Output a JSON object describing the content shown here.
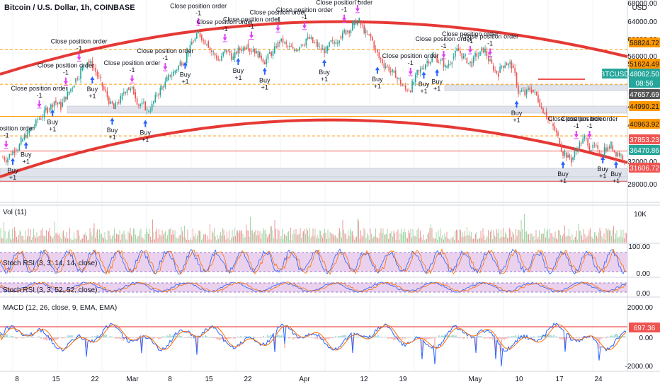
{
  "header": {
    "title": "Bitcoin / U.S. Dollar, 1h, COINBASE",
    "currency": "USD"
  },
  "chart_data": {
    "type": "candlestick",
    "symbol": "BTCUSD",
    "price_axis_ticks": [
      "68000.00",
      "64000.00",
      "60000.00",
      "56000.00",
      "52000.00",
      "48000.00",
      "44000.00",
      "40000.00",
      "32000.00",
      "28000.00"
    ],
    "price_labels": [
      {
        "value": "58824.72",
        "color": "#ff9800",
        "text_color": "#131722"
      },
      {
        "value": "51624.49",
        "color": "#ff9800",
        "text_color": "#131722"
      },
      {
        "value": "BTCUSD",
        "color": "#26a69a",
        "text_color": "#ffffff"
      },
      {
        "value": "48062.50",
        "color": "#26a69a",
        "text_color": "#ffffff"
      },
      {
        "value": "08:56",
        "color": "#26a69a",
        "text_color": "#ffffff"
      },
      {
        "value": "47657.69",
        "color": "#555555",
        "text_color": "#ffffff"
      },
      {
        "value": "44990.21",
        "color": "#ff9800",
        "text_color": "#131722"
      },
      {
        "value": "40963.92",
        "color": "#ff9800",
        "text_color": "#131722"
      },
      {
        "value": "37853.23",
        "color": "#ef5350",
        "text_color": "#ffffff"
      },
      {
        "value": "36470.86",
        "color": "#26a69a",
        "text_color": "#ffffff"
      },
      {
        "value": "31606.72",
        "color": "#ef5350",
        "text_color": "#ffffff"
      }
    ],
    "horizontal_levels": [
      58824.72,
      51624.49,
      44990.21,
      40963.92,
      37853.23,
      31606.72
    ],
    "x_ticks": [
      "8",
      "15",
      "22",
      "Mar",
      "8",
      "15",
      "22",
      "Apr",
      "12",
      "19",
      "May",
      "10",
      "17",
      "24"
    ],
    "closes": [
      36500,
      38200,
      39800,
      41500,
      43000,
      44800,
      46500,
      48200,
      47000,
      49500,
      52000,
      54500,
      56500,
      55000,
      52000,
      49000,
      46500,
      48500,
      51000,
      50000,
      47500,
      46000,
      48000,
      50500,
      52500,
      54000,
      56000,
      58000,
      60500,
      61800,
      60500,
      58000,
      56500,
      58500,
      57000,
      58800,
      60000,
      59000,
      57500,
      56800,
      58000,
      60500,
      59500,
      58500,
      59800,
      61000,
      60200,
      59000,
      58500,
      60000,
      61500,
      62500,
      63800,
      64500,
      62000,
      60500,
      57000,
      55500,
      54000,
      52500,
      50500,
      51500,
      54000,
      56000,
      57500,
      56500,
      55000,
      57000,
      58500,
      57000,
      56000,
      57500,
      58500,
      55500,
      54000,
      56000,
      55500,
      50000,
      49500,
      50500,
      48500,
      46000,
      43500,
      40500,
      37500,
      36000,
      38500,
      40500,
      38500,
      37500,
      38500,
      39000,
      37500,
      36470
    ],
    "trades": [
      {
        "side": "buy",
        "text": "Buy",
        "qty": "+1",
        "i": 1
      },
      {
        "side": "buy",
        "text": "Buy",
        "qty": "+1",
        "i": 3
      },
      {
        "side": "buy",
        "text": "Buy",
        "qty": "+1",
        "i": 7
      },
      {
        "side": "buy",
        "text": "Buy",
        "qty": "+1",
        "i": 13
      },
      {
        "side": "buy",
        "text": "Buy",
        "qty": "+1",
        "i": 16
      },
      {
        "side": "buy",
        "text": "Buy",
        "qty": "+1",
        "i": 21
      },
      {
        "side": "buy",
        "text": "Buy",
        "qty": "+1",
        "i": 27
      },
      {
        "side": "buy",
        "text": "Buy",
        "qty": "+1",
        "i": 35
      },
      {
        "side": "buy",
        "text": "Buy",
        "qty": "+1",
        "i": 39
      },
      {
        "side": "buy",
        "text": "Buy",
        "qty": "+1",
        "i": 48
      },
      {
        "side": "buy",
        "text": "Buy",
        "qty": "+1",
        "i": 56
      },
      {
        "side": "buy",
        "text": "Buy",
        "qty": "+1",
        "i": 63
      },
      {
        "side": "buy",
        "text": "Buy",
        "qty": "+1",
        "i": 65
      },
      {
        "side": "buy",
        "text": "Buy",
        "qty": "+1",
        "i": 77
      },
      {
        "side": "buy",
        "text": "Buy",
        "qty": "+1",
        "i": 84
      },
      {
        "side": "buy",
        "text": "Buy",
        "qty": "+1",
        "i": 90
      },
      {
        "side": "buy",
        "text": "Buy",
        "qty": "+1",
        "i": 92
      },
      {
        "side": "close",
        "text": "Close position order",
        "qty": "-1",
        "i": 0
      },
      {
        "side": "close",
        "text": "Close position order",
        "qty": "-1",
        "i": 5
      },
      {
        "side": "close",
        "text": "Close position order",
        "qty": "-1",
        "i": 9
      },
      {
        "side": "close",
        "text": "Close position order",
        "qty": "-1",
        "i": 11
      },
      {
        "side": "close",
        "text": "Close position order",
        "qty": "-1",
        "i": 19
      },
      {
        "side": "close",
        "text": "Close position order",
        "qty": "-1",
        "i": 24
      },
      {
        "side": "close",
        "text": "Close position order",
        "qty": "-1",
        "i": 29
      },
      {
        "side": "close",
        "text": "Close position order",
        "qty": "-1",
        "i": 33
      },
      {
        "side": "close",
        "text": "Close position order",
        "qty": "-1",
        "i": 37
      },
      {
        "side": "close",
        "text": "Close position order",
        "qty": "-1",
        "i": 41
      },
      {
        "side": "close",
        "text": "Close position order",
        "qty": "-1",
        "i": 45
      },
      {
        "side": "close",
        "text": "Close position order",
        "qty": "-1",
        "i": 51
      },
      {
        "side": "close",
        "text": "Close position order",
        "qty": "-1",
        "i": 53
      },
      {
        "side": "close",
        "text": "Close position order",
        "qty": "-1",
        "i": 61
      },
      {
        "side": "close",
        "text": "Close position order",
        "qty": "-1",
        "i": 66
      },
      {
        "side": "close",
        "text": "Close position order",
        "qty": "-1",
        "i": 70
      },
      {
        "side": "close",
        "text": "Close position order",
        "qty": "-1",
        "i": 73
      },
      {
        "side": "close",
        "text": "Close position order",
        "qty": "-1",
        "i": 86
      },
      {
        "side": "close",
        "text": "Close position order",
        "qty": "-1",
        "i": 88
      }
    ],
    "volume": {
      "title": "Vol (11)",
      "ticks": [
        "10K"
      ]
    },
    "stoch_rsi_1": {
      "title": "Stoch RSI (3, 3, 14, 14, close)",
      "ticks": [
        "100.00",
        "0.00"
      ]
    },
    "stoch_rsi_2": {
      "title": "Stoch RSI (3, 3, 52, 52, close)",
      "ticks": [
        "0.00"
      ]
    },
    "macd": {
      "title": "MACD (12, 26, close, 9, EMA, EMA)",
      "ticks": [
        "2000.00",
        "0.00",
        "-2000.00"
      ],
      "last": "697.36"
    }
  }
}
